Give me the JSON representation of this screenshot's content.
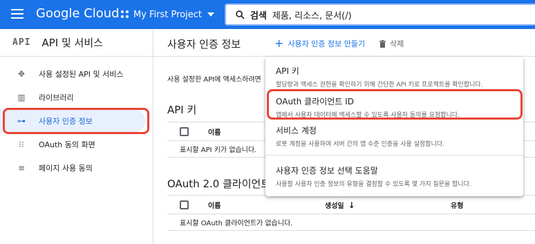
{
  "topbar": {
    "logo": "Google Cloud",
    "project": "My First Project",
    "search_keyword": "검색",
    "search_placeholder": "제품, 리소스, 문서(/)"
  },
  "sidebar": {
    "api_mark": "API",
    "title": "API 및 서비스",
    "items": [
      {
        "label": "사용 설정된 API 및 서비스",
        "icon": "enabled-apis-icon"
      },
      {
        "label": "라이브러리",
        "icon": "library-icon"
      },
      {
        "label": "사용자 인증 정보",
        "icon": "key-icon",
        "active": true
      },
      {
        "label": "OAuth 동의 화면",
        "icon": "consent-icon"
      },
      {
        "label": "페이지 사용 동의",
        "icon": "agreement-icon"
      }
    ]
  },
  "main": {
    "title": "사용자 인증 정보",
    "create_label": "사용자 인증 정보 만들기",
    "delete_label": "삭제",
    "description": "사용 설정한 API에 액세스하려면",
    "api_keys": {
      "heading": "API 키",
      "col_name": "이름",
      "empty": "표시할 API 키가 없습니다."
    },
    "oauth": {
      "heading": "OAuth 2.0 클라이언트",
      "col_name": "이름",
      "col_date": "생성일",
      "col_type": "유형",
      "empty": "표시할 OAuth 클라이언트가 없습니다."
    }
  },
  "menu": {
    "items": [
      {
        "title": "API 키",
        "subtitle": "할당량과 액세스 권한을 확인하기 위해 간단한 API 키로 프로젝트를 확인합니다."
      },
      {
        "title": "OAuth 클라이언트 ID",
        "subtitle": "앱에서 사용자 데이터에 액세스할 수 있도록 사용자 동의를 요청합니다."
      },
      {
        "title": "서비스 계정",
        "subtitle": "로봇 계정을 사용하여 서버 간의 앱 수준 인증을 사용 설정합니다."
      },
      {
        "title": "사용자 인증 정보 선택 도움말",
        "subtitle": "사용할 사용자 인증 정보의 유형을 결정할 수 있도록 몇 가지 질문을 합니다."
      }
    ]
  },
  "colors": {
    "brand_blue": "#1a73e8",
    "highlight_red": "#ea4335",
    "active_bg": "#e8f0fe"
  }
}
